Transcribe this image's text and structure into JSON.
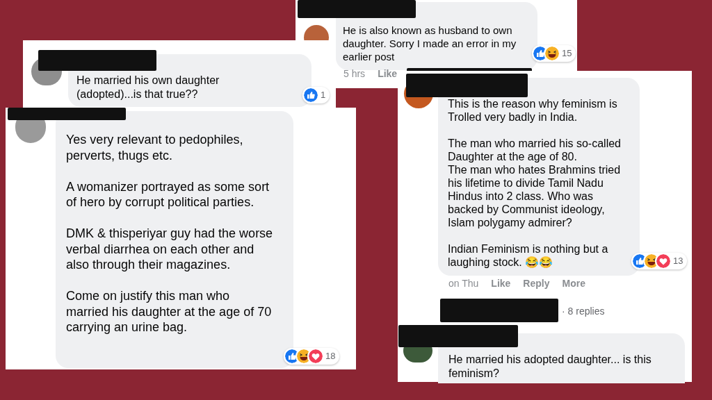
{
  "comments": [
    {
      "text": "He is also known as husband to own daughter. Sorry I made an error in my earlier post",
      "reactions": [
        {
          "kind": "like"
        },
        {
          "kind": "haha"
        }
      ],
      "reaction_count": "15",
      "actions": [
        "5 hrs",
        "Like"
      ]
    },
    {
      "text": "He married his own daughter (adopted)...is that true??",
      "reactions": [
        {
          "kind": "like"
        }
      ],
      "reaction_count": "1"
    },
    {
      "text": "Yes very relevant to pedophiles, perverts, thugs etc.\n\nA womanizer portrayed as some sort of hero by corrupt political parties.\n\nDMK & thisperiyar guy had the worse verbal diarrhea on each other and also through their magazines.\n\nCome on justify this man who married his daughter at the age of 70 carrying an urine bag.",
      "reactions": [
        {
          "kind": "like"
        },
        {
          "kind": "haha"
        },
        {
          "kind": "love"
        }
      ],
      "reaction_count": "18"
    },
    {
      "text": "This is the reason why feminism is Trolled very badly in India.\n\nThe man who married his so-called Daughter at the age of 80.\nThe man who hates Brahmins tried his lifetime to divide Tamil Nadu Hindus into 2 class. Who was backed by Communist ideology, Islam polygamy admirer?\n\nIndian Feminism is nothing but a laughing stock. 😂😂",
      "reactions": [
        {
          "kind": "like"
        },
        {
          "kind": "haha"
        },
        {
          "kind": "love"
        }
      ],
      "reaction_count": "13",
      "actions": [
        "on Thu",
        "Like",
        "Reply",
        "More"
      ],
      "replies_link": "· 8 replies",
      "reply": {
        "text": "He married his adopted daughter... is this feminism?"
      }
    }
  ]
}
